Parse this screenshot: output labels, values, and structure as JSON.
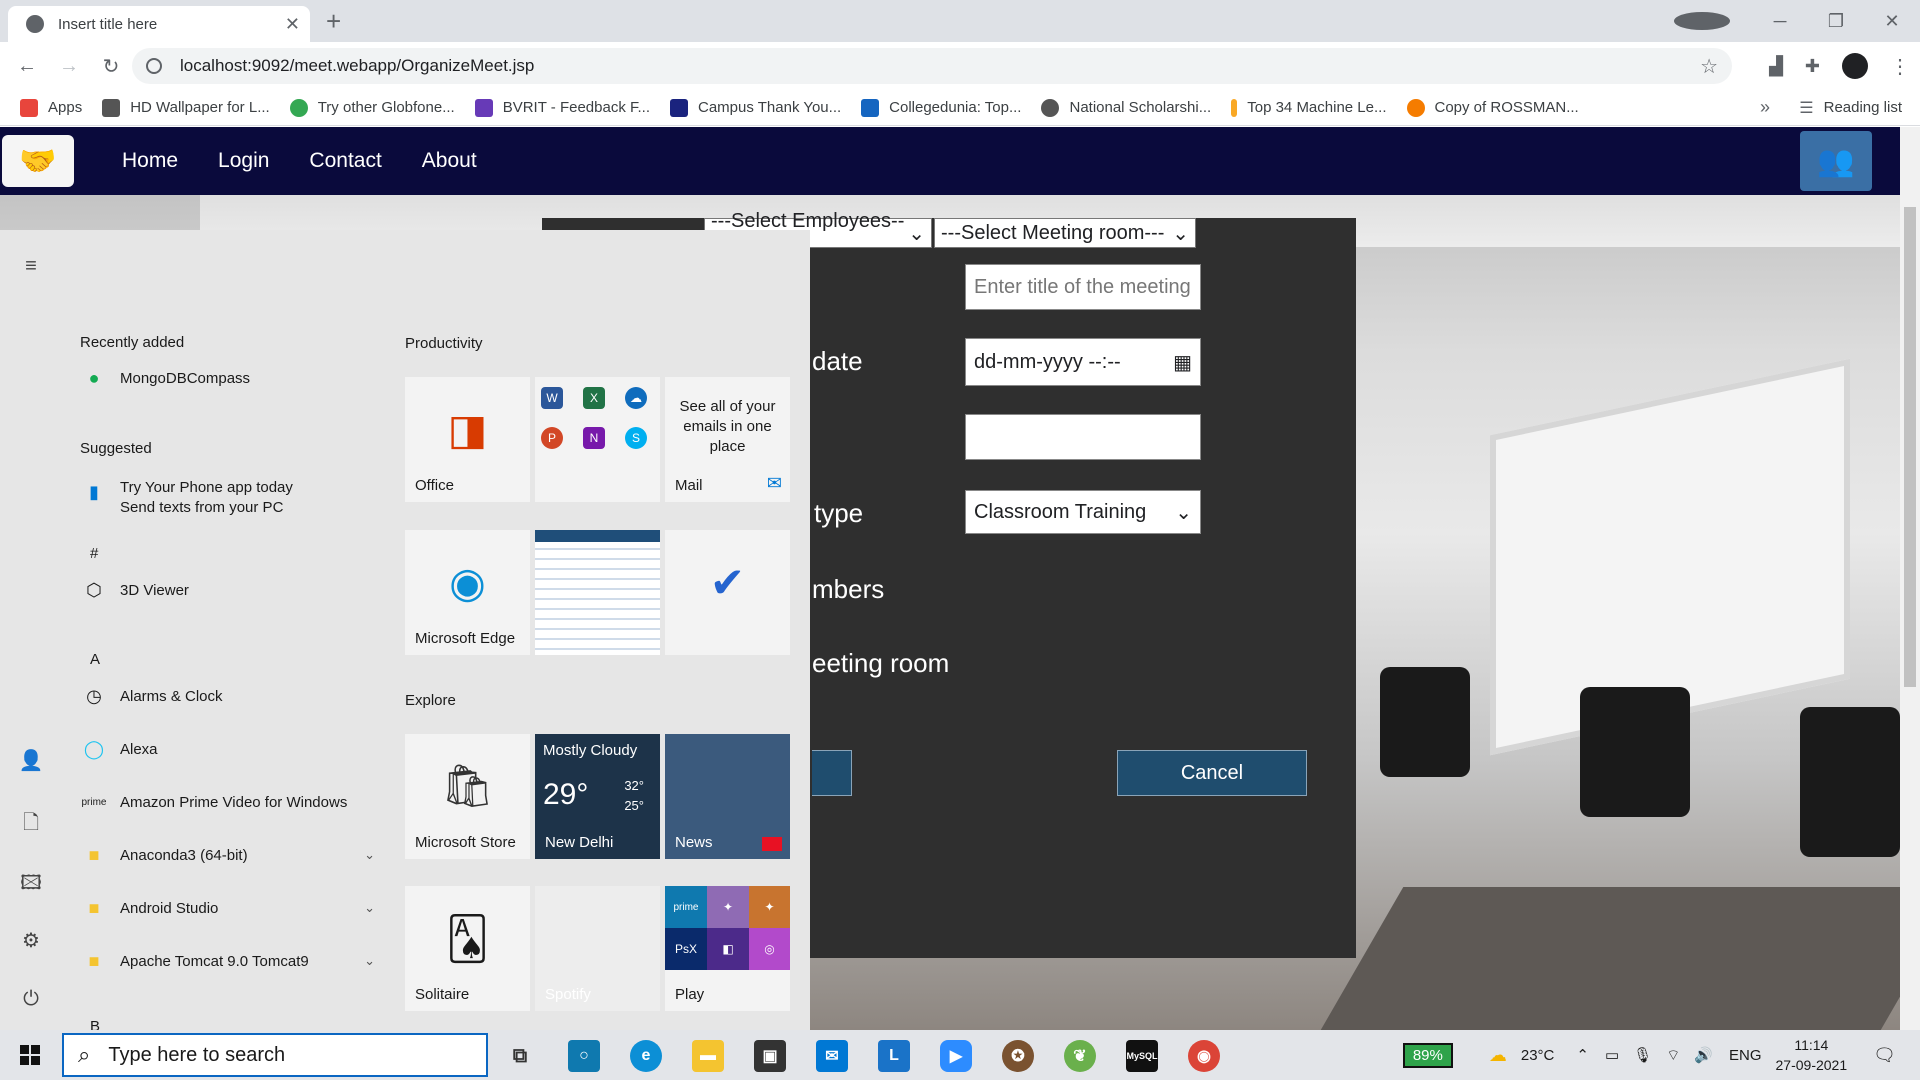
{
  "browser": {
    "tab_title": "Insert title here",
    "url": "localhost:9092/meet.webapp/OrganizeMeet.jsp",
    "bookmarks": [
      {
        "label": "Apps",
        "color": "#e8453c"
      },
      {
        "label": "HD Wallpaper for L...",
        "color": "#555555"
      },
      {
        "label": "Try other Globfone...",
        "color": "#34a853"
      },
      {
        "label": "BVRIT - Feedback F...",
        "color": "#673ab7"
      },
      {
        "label": "Campus Thank You...",
        "color": "#1a237e"
      },
      {
        "label": "Collegedunia: Top...",
        "color": "#1565c0"
      },
      {
        "label": "National Scholarshi...",
        "color": "#555555"
      },
      {
        "label": "Top 34 Machine Le...",
        "color": "#f9a825"
      },
      {
        "label": "Copy of ROSSMAN...",
        "color": "#f57c00"
      }
    ],
    "reading_list": "Reading list"
  },
  "site": {
    "nav": [
      "Home",
      "Login",
      "Contact",
      "About"
    ],
    "colors": {
      "navbar": "#0a0a3c",
      "button": "#1f4d6e",
      "panel": "#2f2f2f"
    }
  },
  "form": {
    "employees_select": "---Select Employees---",
    "room_select": "---Select Meeting room---",
    "title_placeholder": "Enter title of the meeting",
    "date_label": "date",
    "date_value": "dd-mm-yyyy --:--",
    "type_label": "type",
    "type_value": "Classroom Training",
    "members_label": "mbers",
    "room_label": "eeting room",
    "cancel": "Cancel"
  },
  "start_menu": {
    "recently_added": "Recently added",
    "recent_items": [
      "MongoDBCompass"
    ],
    "suggested": "Suggested",
    "suggested_line1": "Try Your Phone app today",
    "suggested_line2": "Send texts from your PC",
    "letters": [
      "#",
      "A",
      "B"
    ],
    "apps": [
      {
        "label": "3D Viewer",
        "icon": "cube-icon"
      },
      {
        "label": "Alarms & Clock",
        "icon": "clock-icon"
      },
      {
        "label": "Alexa",
        "icon": "alexa-icon"
      },
      {
        "label": "Amazon Prime Video for Windows",
        "icon": "prime-video-icon"
      },
      {
        "label": "Anaconda3 (64-bit)",
        "icon": "folder-icon"
      },
      {
        "label": "Android Studio",
        "icon": "folder-icon"
      },
      {
        "label": "Apache Tomcat 9.0 Tomcat9",
        "icon": "folder-icon"
      }
    ],
    "groups": {
      "productivity": "Productivity",
      "explore": "Explore"
    },
    "tiles": {
      "office": "Office",
      "mail_text": "See all of your emails in one place",
      "mail": "Mail",
      "edge": "Microsoft Edge",
      "store": "Microsoft Store",
      "weather_cond": "Mostly Cloudy",
      "weather_temp": "29°",
      "weather_hi": "32°",
      "weather_lo": "25°",
      "weather_city": "New Delhi",
      "news": "News",
      "solitaire": "Solitaire",
      "spotify": "Spotify",
      "play": "Play"
    }
  },
  "taskbar": {
    "search_placeholder": "Type here to search",
    "battery": "89%",
    "temperature": "23°C",
    "language": "ENG",
    "time": "11:14",
    "date": "27-09-2021"
  }
}
